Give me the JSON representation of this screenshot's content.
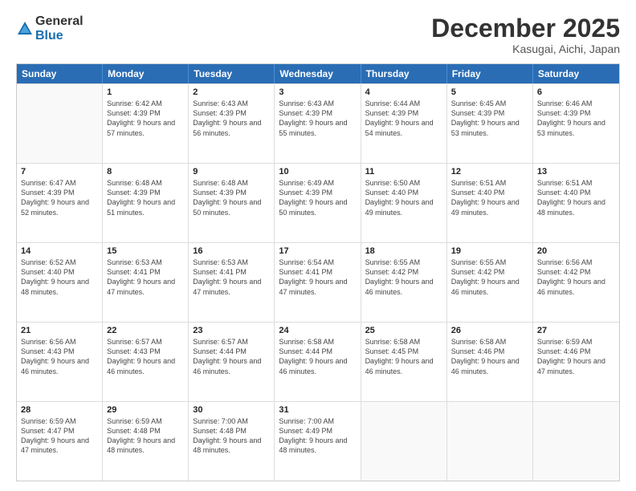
{
  "logo": {
    "general": "General",
    "blue": "Blue"
  },
  "title": "December 2025",
  "location": "Kasugai, Aichi, Japan",
  "headers": [
    "Sunday",
    "Monday",
    "Tuesday",
    "Wednesday",
    "Thursday",
    "Friday",
    "Saturday"
  ],
  "weeks": [
    [
      {
        "day": "",
        "sunrise": "",
        "sunset": "",
        "daylight": "",
        "empty": true
      },
      {
        "day": "1",
        "sunrise": "Sunrise: 6:42 AM",
        "sunset": "Sunset: 4:39 PM",
        "daylight": "Daylight: 9 hours and 57 minutes."
      },
      {
        "day": "2",
        "sunrise": "Sunrise: 6:43 AM",
        "sunset": "Sunset: 4:39 PM",
        "daylight": "Daylight: 9 hours and 56 minutes."
      },
      {
        "day": "3",
        "sunrise": "Sunrise: 6:43 AM",
        "sunset": "Sunset: 4:39 PM",
        "daylight": "Daylight: 9 hours and 55 minutes."
      },
      {
        "day": "4",
        "sunrise": "Sunrise: 6:44 AM",
        "sunset": "Sunset: 4:39 PM",
        "daylight": "Daylight: 9 hours and 54 minutes."
      },
      {
        "day": "5",
        "sunrise": "Sunrise: 6:45 AM",
        "sunset": "Sunset: 4:39 PM",
        "daylight": "Daylight: 9 hours and 53 minutes."
      },
      {
        "day": "6",
        "sunrise": "Sunrise: 6:46 AM",
        "sunset": "Sunset: 4:39 PM",
        "daylight": "Daylight: 9 hours and 53 minutes."
      }
    ],
    [
      {
        "day": "7",
        "sunrise": "Sunrise: 6:47 AM",
        "sunset": "Sunset: 4:39 PM",
        "daylight": "Daylight: 9 hours and 52 minutes."
      },
      {
        "day": "8",
        "sunrise": "Sunrise: 6:48 AM",
        "sunset": "Sunset: 4:39 PM",
        "daylight": "Daylight: 9 hours and 51 minutes."
      },
      {
        "day": "9",
        "sunrise": "Sunrise: 6:48 AM",
        "sunset": "Sunset: 4:39 PM",
        "daylight": "Daylight: 9 hours and 50 minutes."
      },
      {
        "day": "10",
        "sunrise": "Sunrise: 6:49 AM",
        "sunset": "Sunset: 4:39 PM",
        "daylight": "Daylight: 9 hours and 50 minutes."
      },
      {
        "day": "11",
        "sunrise": "Sunrise: 6:50 AM",
        "sunset": "Sunset: 4:40 PM",
        "daylight": "Daylight: 9 hours and 49 minutes."
      },
      {
        "day": "12",
        "sunrise": "Sunrise: 6:51 AM",
        "sunset": "Sunset: 4:40 PM",
        "daylight": "Daylight: 9 hours and 49 minutes."
      },
      {
        "day": "13",
        "sunrise": "Sunrise: 6:51 AM",
        "sunset": "Sunset: 4:40 PM",
        "daylight": "Daylight: 9 hours and 48 minutes."
      }
    ],
    [
      {
        "day": "14",
        "sunrise": "Sunrise: 6:52 AM",
        "sunset": "Sunset: 4:40 PM",
        "daylight": "Daylight: 9 hours and 48 minutes."
      },
      {
        "day": "15",
        "sunrise": "Sunrise: 6:53 AM",
        "sunset": "Sunset: 4:41 PM",
        "daylight": "Daylight: 9 hours and 47 minutes."
      },
      {
        "day": "16",
        "sunrise": "Sunrise: 6:53 AM",
        "sunset": "Sunset: 4:41 PM",
        "daylight": "Daylight: 9 hours and 47 minutes."
      },
      {
        "day": "17",
        "sunrise": "Sunrise: 6:54 AM",
        "sunset": "Sunset: 4:41 PM",
        "daylight": "Daylight: 9 hours and 47 minutes."
      },
      {
        "day": "18",
        "sunrise": "Sunrise: 6:55 AM",
        "sunset": "Sunset: 4:42 PM",
        "daylight": "Daylight: 9 hours and 46 minutes."
      },
      {
        "day": "19",
        "sunrise": "Sunrise: 6:55 AM",
        "sunset": "Sunset: 4:42 PM",
        "daylight": "Daylight: 9 hours and 46 minutes."
      },
      {
        "day": "20",
        "sunrise": "Sunrise: 6:56 AM",
        "sunset": "Sunset: 4:42 PM",
        "daylight": "Daylight: 9 hours and 46 minutes."
      }
    ],
    [
      {
        "day": "21",
        "sunrise": "Sunrise: 6:56 AM",
        "sunset": "Sunset: 4:43 PM",
        "daylight": "Daylight: 9 hours and 46 minutes."
      },
      {
        "day": "22",
        "sunrise": "Sunrise: 6:57 AM",
        "sunset": "Sunset: 4:43 PM",
        "daylight": "Daylight: 9 hours and 46 minutes."
      },
      {
        "day": "23",
        "sunrise": "Sunrise: 6:57 AM",
        "sunset": "Sunset: 4:44 PM",
        "daylight": "Daylight: 9 hours and 46 minutes."
      },
      {
        "day": "24",
        "sunrise": "Sunrise: 6:58 AM",
        "sunset": "Sunset: 4:44 PM",
        "daylight": "Daylight: 9 hours and 46 minutes."
      },
      {
        "day": "25",
        "sunrise": "Sunrise: 6:58 AM",
        "sunset": "Sunset: 4:45 PM",
        "daylight": "Daylight: 9 hours and 46 minutes."
      },
      {
        "day": "26",
        "sunrise": "Sunrise: 6:58 AM",
        "sunset": "Sunset: 4:46 PM",
        "daylight": "Daylight: 9 hours and 46 minutes."
      },
      {
        "day": "27",
        "sunrise": "Sunrise: 6:59 AM",
        "sunset": "Sunset: 4:46 PM",
        "daylight": "Daylight: 9 hours and 47 minutes."
      }
    ],
    [
      {
        "day": "28",
        "sunrise": "Sunrise: 6:59 AM",
        "sunset": "Sunset: 4:47 PM",
        "daylight": "Daylight: 9 hours and 47 minutes."
      },
      {
        "day": "29",
        "sunrise": "Sunrise: 6:59 AM",
        "sunset": "Sunset: 4:48 PM",
        "daylight": "Daylight: 9 hours and 48 minutes."
      },
      {
        "day": "30",
        "sunrise": "Sunrise: 7:00 AM",
        "sunset": "Sunset: 4:48 PM",
        "daylight": "Daylight: 9 hours and 48 minutes."
      },
      {
        "day": "31",
        "sunrise": "Sunrise: 7:00 AM",
        "sunset": "Sunset: 4:49 PM",
        "daylight": "Daylight: 9 hours and 48 minutes."
      },
      {
        "day": "",
        "sunrise": "",
        "sunset": "",
        "daylight": "",
        "empty": true
      },
      {
        "day": "",
        "sunrise": "",
        "sunset": "",
        "daylight": "",
        "empty": true
      },
      {
        "day": "",
        "sunrise": "",
        "sunset": "",
        "daylight": "",
        "empty": true
      }
    ]
  ]
}
